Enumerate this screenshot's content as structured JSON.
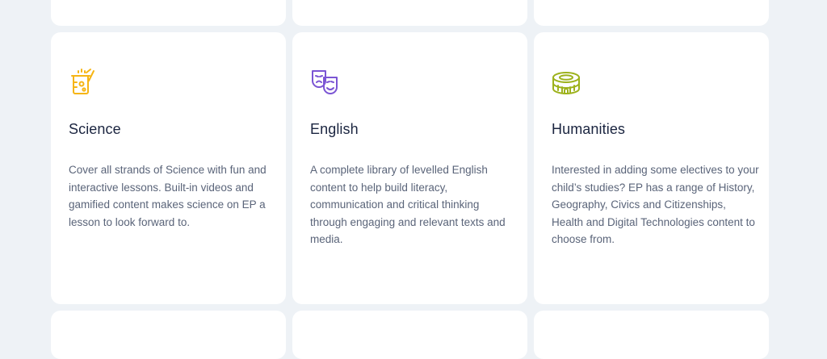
{
  "colors": {
    "page_background": "#eef2f6",
    "card_background": "#ffffff",
    "science_icon": "#f6b515",
    "english_icon": "#7b55d4",
    "humanities_icon": "#9db21c"
  },
  "cards": [
    {
      "icon": "science-beaker-icon",
      "title": "Science",
      "description": "Cover all strands of Science with fun and interactive lessons. Built-in videos and gamified content makes science on EP a lesson to look forward to."
    },
    {
      "icon": "theatre-masks-icon",
      "title": "English",
      "description": "A complete library of levelled English content to help build literacy, communication and critical thinking through engaging and relevant texts and media."
    },
    {
      "icon": "colosseum-icon",
      "title": "Humanities",
      "description": "Interested in adding some electives to your child’s studies? EP has a range of History, Geography, Civics and Citizenships, Health and Digital Technologies content to choose from."
    }
  ]
}
